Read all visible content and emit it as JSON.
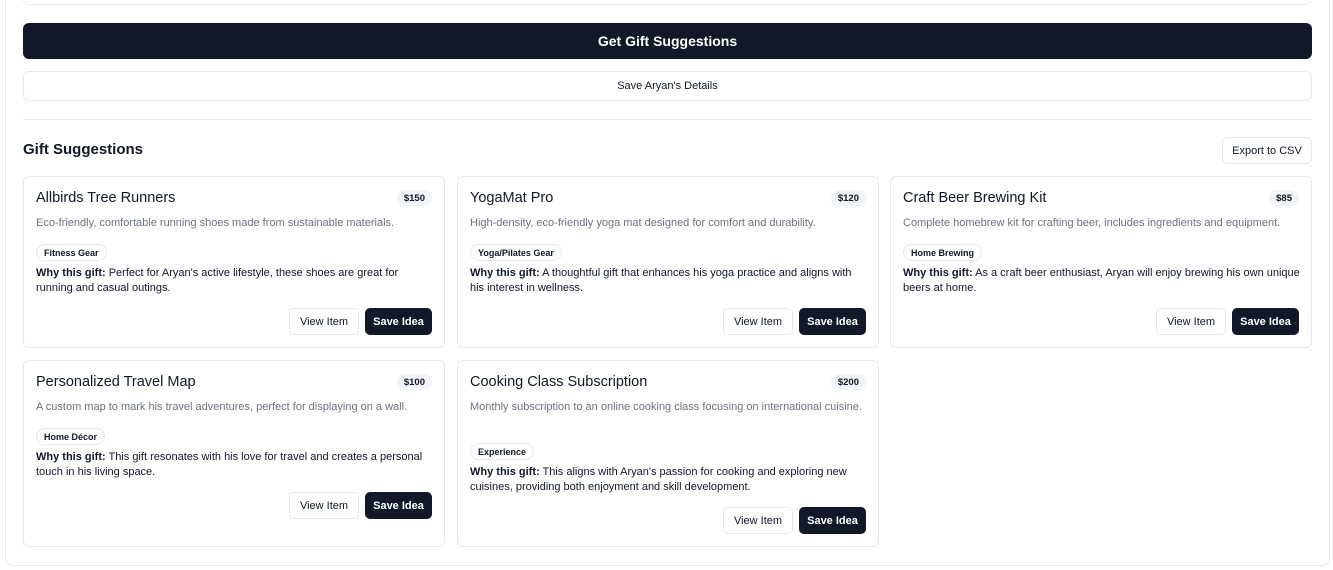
{
  "actions": {
    "get_suggestions_label": "Get Gift Suggestions",
    "save_details_label": "Save Aryan's Details"
  },
  "suggestions": {
    "title": "Gift Suggestions",
    "export_label": "Export to CSV",
    "why_label": "Why this gift:",
    "view_label": "View Item",
    "save_label": "Save Idea",
    "items": [
      {
        "name": "Allbirds Tree Runners",
        "price": "$150",
        "description": "Eco-friendly, comfortable running shoes made from sustainable materials.",
        "category": "Fitness Gear",
        "reason": "Perfect for Aryan's active lifestyle, these shoes are great for running and casual outings."
      },
      {
        "name": "YogaMat Pro",
        "price": "$120",
        "description": "High-density, eco-friendly yoga mat designed for comfort and durability.",
        "category": "Yoga/Pilates Gear",
        "reason": "A thoughtful gift that enhances his yoga practice and aligns with his interest in wellness."
      },
      {
        "name": "Craft Beer Brewing Kit",
        "price": "$85",
        "description": "Complete homebrew kit for crafting beer, includes ingredients and equipment.",
        "category": "Home Brewing",
        "reason": "As a craft beer enthusiast, Aryan will enjoy brewing his own unique beers at home."
      },
      {
        "name": "Personalized Travel Map",
        "price": "$100",
        "description": "A custom map to mark his travel adventures, perfect for displaying on a wall.",
        "category": "Home Décor",
        "reason": "This gift resonates with his love for travel and creates a personal touch in his living space."
      },
      {
        "name": "Cooking Class Subscription",
        "price": "$200",
        "description": "Monthly subscription to an online cooking class focusing on international cuisine.",
        "category": "Experience",
        "reason": "This aligns with Aryan's passion for cooking and exploring new cuisines, providing both enjoyment and skill development."
      }
    ]
  }
}
